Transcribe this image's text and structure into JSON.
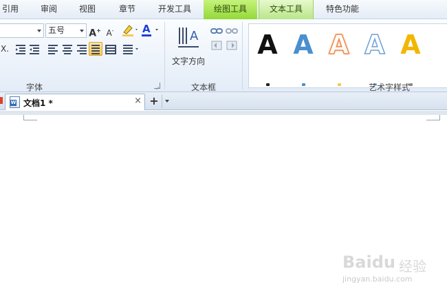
{
  "menu_tabs": [
    {
      "label": "引用"
    },
    {
      "label": "审阅"
    },
    {
      "label": "视图"
    },
    {
      "label": "章节"
    },
    {
      "label": "开发工具"
    },
    {
      "label": "绘图工具"
    },
    {
      "label": "文本工具"
    },
    {
      "label": "特色功能"
    }
  ],
  "ribbon": {
    "font_group": {
      "font_size": "五号",
      "label": "字体"
    },
    "textbox_group": {
      "text_direction_label": "文字方向",
      "label": "文本框"
    },
    "wordart_group": {
      "glyph": "A",
      "label": "艺术字样式",
      "style_colors": [
        "#111111",
        "#4a8fd0",
        "#f08a4b",
        "#6e9fd6",
        "#f2b600"
      ]
    }
  },
  "doc_tab": {
    "title": "文档1 *",
    "close_symbol": "×",
    "new_tab_symbol": "+"
  },
  "watermark": {
    "logo": "Baidu",
    "suffix": "经验",
    "url": "jingyan.baidu.com"
  },
  "colors": {
    "context_tab_green": "#93d93a",
    "highlight_yellow": "#f8c954",
    "font_color_blue": "#1f3fd6"
  }
}
